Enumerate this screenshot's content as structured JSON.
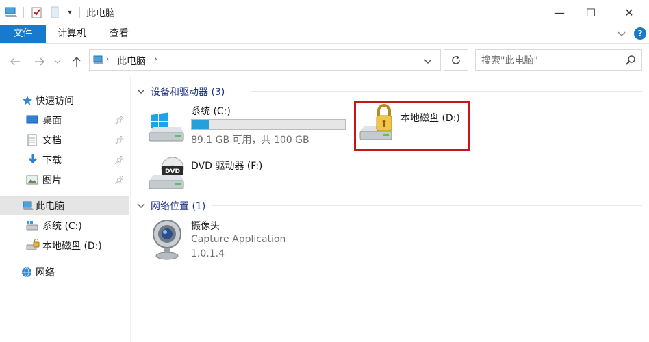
{
  "window": {
    "title": "此电脑",
    "minimize_glyph": "—",
    "maximize_glyph": "☐",
    "close_glyph": "✕"
  },
  "ribbon": {
    "tabs": [
      {
        "label": "文件"
      },
      {
        "label": "计算机"
      },
      {
        "label": "查看"
      }
    ]
  },
  "address": {
    "path": [
      "此电脑"
    ]
  },
  "search": {
    "placeholder": "搜索\"此电脑\""
  },
  "nav_pane": {
    "items": [
      {
        "label": "快速访问",
        "icon": "star-icon"
      },
      {
        "label": "桌面",
        "icon": "desktop-icon",
        "pinned": true
      },
      {
        "label": "文档",
        "icon": "document-icon",
        "pinned": true
      },
      {
        "label": "下载",
        "icon": "download-icon",
        "pinned": true
      },
      {
        "label": "图片",
        "icon": "pictures-icon",
        "pinned": true
      },
      {
        "label": "此电脑",
        "icon": "computer-icon",
        "selected": true
      },
      {
        "label": "系统 (C:)",
        "icon": "drive-icon"
      },
      {
        "label": "本地磁盘 (D:)",
        "icon": "locked-drive-icon"
      },
      {
        "label": "网络",
        "icon": "network-icon"
      }
    ]
  },
  "groups": {
    "devices": {
      "header": "设备和驱动器 (3)",
      "items": [
        {
          "name": "系统 (C:)",
          "sub": "89.1 GB 可用，共 100 GB",
          "used_fraction": 0.11,
          "icon": "windows-drive-icon"
        },
        {
          "name": "本地磁盘 (D:)",
          "icon": "locked-drive-icon"
        },
        {
          "name": "DVD 驱动器 (F:)",
          "icon": "dvd-drive-icon"
        }
      ]
    },
    "network": {
      "header": "网络位置 (1)",
      "items": [
        {
          "name": "摄像头",
          "sub1": "Capture Application",
          "sub2": "1.0.1.4",
          "icon": "webcam-icon"
        }
      ]
    }
  },
  "colors": {
    "accent": "#1979ca",
    "progress": "#26a0da",
    "highlight_box": "#c4161c",
    "group_header": "#1e3287"
  }
}
